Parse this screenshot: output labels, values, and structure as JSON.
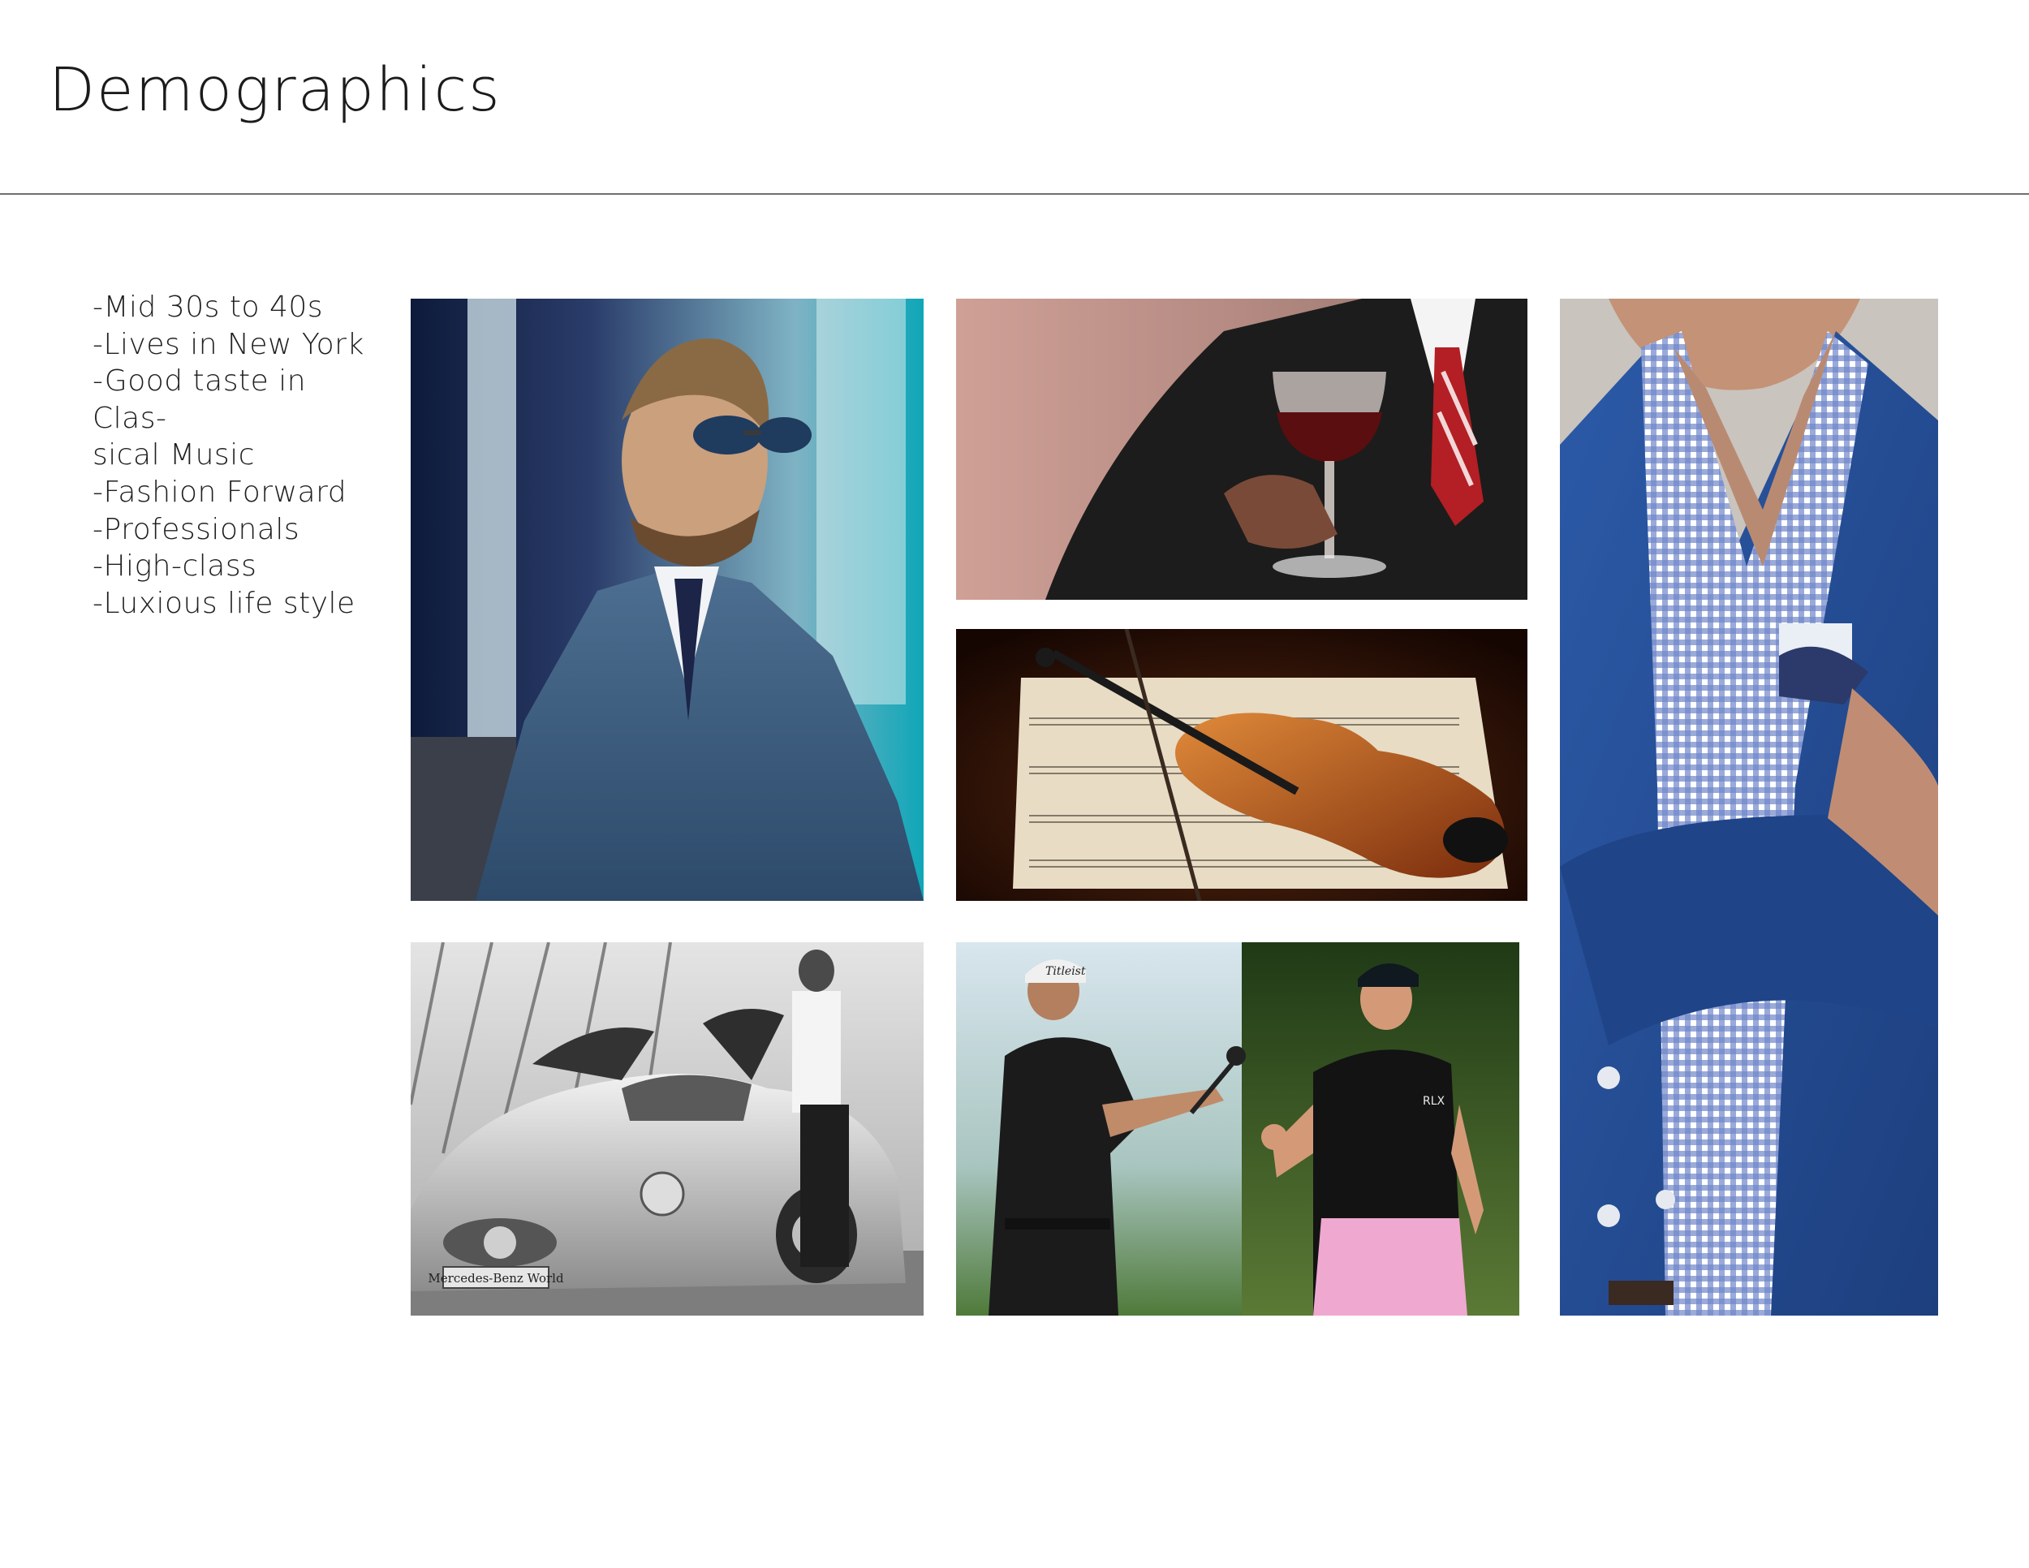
{
  "slide": {
    "title": "Demographics",
    "bullets": [
      "-Mid 30s to 40s",
      "-Lives in New York",
      "-Good taste in Clas-",
      "sical Music",
      "-Fashion Forward",
      "-Professionals",
      "-High-class",
      "-Luxious life style"
    ]
  },
  "photos": {
    "car_plate": "Mercedes-Benz World",
    "golf_shirt_logo": "RLX",
    "golf_cap_logo": "Titleist"
  }
}
